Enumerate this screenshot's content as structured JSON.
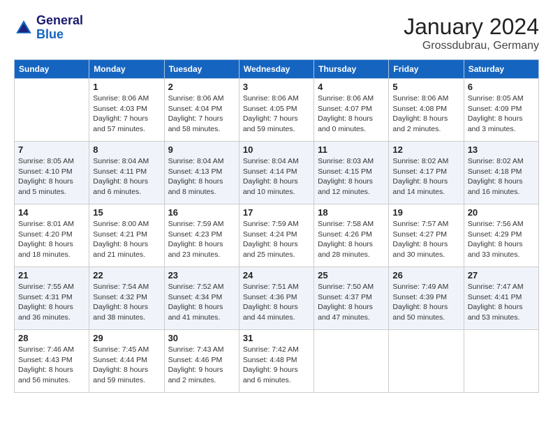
{
  "logo": {
    "text_general": "General",
    "text_blue": "Blue"
  },
  "title": "January 2024",
  "location": "Grossdubrau, Germany",
  "days_of_week": [
    "Sunday",
    "Monday",
    "Tuesday",
    "Wednesday",
    "Thursday",
    "Friday",
    "Saturday"
  ],
  "weeks": [
    [
      {
        "day": "",
        "info": ""
      },
      {
        "day": "1",
        "info": "Sunrise: 8:06 AM\nSunset: 4:03 PM\nDaylight: 7 hours\nand 57 minutes."
      },
      {
        "day": "2",
        "info": "Sunrise: 8:06 AM\nSunset: 4:04 PM\nDaylight: 7 hours\nand 58 minutes."
      },
      {
        "day": "3",
        "info": "Sunrise: 8:06 AM\nSunset: 4:05 PM\nDaylight: 7 hours\nand 59 minutes."
      },
      {
        "day": "4",
        "info": "Sunrise: 8:06 AM\nSunset: 4:07 PM\nDaylight: 8 hours\nand 0 minutes."
      },
      {
        "day": "5",
        "info": "Sunrise: 8:06 AM\nSunset: 4:08 PM\nDaylight: 8 hours\nand 2 minutes."
      },
      {
        "day": "6",
        "info": "Sunrise: 8:05 AM\nSunset: 4:09 PM\nDaylight: 8 hours\nand 3 minutes."
      }
    ],
    [
      {
        "day": "7",
        "info": "Sunrise: 8:05 AM\nSunset: 4:10 PM\nDaylight: 8 hours\nand 5 minutes."
      },
      {
        "day": "8",
        "info": "Sunrise: 8:04 AM\nSunset: 4:11 PM\nDaylight: 8 hours\nand 6 minutes."
      },
      {
        "day": "9",
        "info": "Sunrise: 8:04 AM\nSunset: 4:13 PM\nDaylight: 8 hours\nand 8 minutes."
      },
      {
        "day": "10",
        "info": "Sunrise: 8:04 AM\nSunset: 4:14 PM\nDaylight: 8 hours\nand 10 minutes."
      },
      {
        "day": "11",
        "info": "Sunrise: 8:03 AM\nSunset: 4:15 PM\nDaylight: 8 hours\nand 12 minutes."
      },
      {
        "day": "12",
        "info": "Sunrise: 8:02 AM\nSunset: 4:17 PM\nDaylight: 8 hours\nand 14 minutes."
      },
      {
        "day": "13",
        "info": "Sunrise: 8:02 AM\nSunset: 4:18 PM\nDaylight: 8 hours\nand 16 minutes."
      }
    ],
    [
      {
        "day": "14",
        "info": "Sunrise: 8:01 AM\nSunset: 4:20 PM\nDaylight: 8 hours\nand 18 minutes."
      },
      {
        "day": "15",
        "info": "Sunrise: 8:00 AM\nSunset: 4:21 PM\nDaylight: 8 hours\nand 21 minutes."
      },
      {
        "day": "16",
        "info": "Sunrise: 7:59 AM\nSunset: 4:23 PM\nDaylight: 8 hours\nand 23 minutes."
      },
      {
        "day": "17",
        "info": "Sunrise: 7:59 AM\nSunset: 4:24 PM\nDaylight: 8 hours\nand 25 minutes."
      },
      {
        "day": "18",
        "info": "Sunrise: 7:58 AM\nSunset: 4:26 PM\nDaylight: 8 hours\nand 28 minutes."
      },
      {
        "day": "19",
        "info": "Sunrise: 7:57 AM\nSunset: 4:27 PM\nDaylight: 8 hours\nand 30 minutes."
      },
      {
        "day": "20",
        "info": "Sunrise: 7:56 AM\nSunset: 4:29 PM\nDaylight: 8 hours\nand 33 minutes."
      }
    ],
    [
      {
        "day": "21",
        "info": "Sunrise: 7:55 AM\nSunset: 4:31 PM\nDaylight: 8 hours\nand 36 minutes."
      },
      {
        "day": "22",
        "info": "Sunrise: 7:54 AM\nSunset: 4:32 PM\nDaylight: 8 hours\nand 38 minutes."
      },
      {
        "day": "23",
        "info": "Sunrise: 7:52 AM\nSunset: 4:34 PM\nDaylight: 8 hours\nand 41 minutes."
      },
      {
        "day": "24",
        "info": "Sunrise: 7:51 AM\nSunset: 4:36 PM\nDaylight: 8 hours\nand 44 minutes."
      },
      {
        "day": "25",
        "info": "Sunrise: 7:50 AM\nSunset: 4:37 PM\nDaylight: 8 hours\nand 47 minutes."
      },
      {
        "day": "26",
        "info": "Sunrise: 7:49 AM\nSunset: 4:39 PM\nDaylight: 8 hours\nand 50 minutes."
      },
      {
        "day": "27",
        "info": "Sunrise: 7:47 AM\nSunset: 4:41 PM\nDaylight: 8 hours\nand 53 minutes."
      }
    ],
    [
      {
        "day": "28",
        "info": "Sunrise: 7:46 AM\nSunset: 4:43 PM\nDaylight: 8 hours\nand 56 minutes."
      },
      {
        "day": "29",
        "info": "Sunrise: 7:45 AM\nSunset: 4:44 PM\nDaylight: 8 hours\nand 59 minutes."
      },
      {
        "day": "30",
        "info": "Sunrise: 7:43 AM\nSunset: 4:46 PM\nDaylight: 9 hours\nand 2 minutes."
      },
      {
        "day": "31",
        "info": "Sunrise: 7:42 AM\nSunset: 4:48 PM\nDaylight: 9 hours\nand 6 minutes."
      },
      {
        "day": "",
        "info": ""
      },
      {
        "day": "",
        "info": ""
      },
      {
        "day": "",
        "info": ""
      }
    ]
  ]
}
